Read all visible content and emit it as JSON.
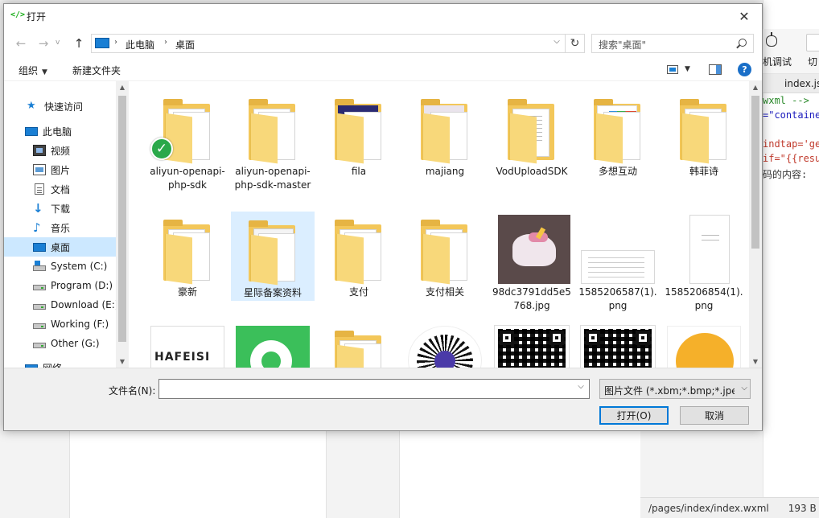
{
  "background": {
    "toolbar_labels": [
      "机调试",
      "切"
    ],
    "tab_label": "index.js",
    "code_lines": [
      {
        "text": "wxml -->",
        "color": "#2a8a2a"
      },
      {
        "text": "=\"containe",
        "color": "#1b1bbd"
      },
      {
        "text": "",
        "color": "#333333"
      },
      {
        "text": "indtap='ge",
        "color": "#c0392b"
      },
      {
        "text": "if=\"{{resu",
        "color": "#c0392b"
      },
      {
        "text": "码的内容:",
        "color": "#333333"
      }
    ],
    "status_path": "/pages/index/index.wxml",
    "status_size": "193 B"
  },
  "dialog": {
    "title": "打开",
    "title_icon": "</>",
    "close_glyph": "✕",
    "nav": {
      "back": "←",
      "forward": "→",
      "recent": "v",
      "up": "↑"
    },
    "address": {
      "segments": [
        "此电脑",
        "桌面"
      ],
      "separator": "›",
      "dropdown": "⌵"
    },
    "refresh_glyph": "↻",
    "search_placeholder": "搜索\"桌面\"",
    "toolbar": {
      "organize": "组织",
      "new_folder": "新建文件夹",
      "caret": "▼",
      "help": "?"
    },
    "sidebar": [
      {
        "label": "快速访问",
        "icon": "star-icon",
        "indent": 28,
        "glyph": "★"
      },
      {
        "label": "此电脑",
        "icon": "computer-icon",
        "indent": 26,
        "glyph": ""
      },
      {
        "label": "视频",
        "icon": "video-icon",
        "indent": 36,
        "glyph": ""
      },
      {
        "label": "图片",
        "icon": "image-icon",
        "indent": 36,
        "glyph": ""
      },
      {
        "label": "文档",
        "icon": "document-icon",
        "indent": 36,
        "glyph": ""
      },
      {
        "label": "下载",
        "icon": "download-icon",
        "indent": 36,
        "glyph": "↓"
      },
      {
        "label": "音乐",
        "icon": "music-icon",
        "indent": 36,
        "glyph": "♪"
      },
      {
        "label": "桌面",
        "icon": "desktop-icon",
        "indent": 36,
        "glyph": "",
        "selected": true
      },
      {
        "label": "System (C:)",
        "icon": "system-drive-icon",
        "indent": 36,
        "glyph": ""
      },
      {
        "label": "Program (D:)",
        "icon": "drive-icon",
        "indent": 36,
        "glyph": ""
      },
      {
        "label": "Download (E:)",
        "icon": "drive-icon",
        "indent": 36,
        "glyph": ""
      },
      {
        "label": "Working (F:)",
        "icon": "drive-icon",
        "indent": 36,
        "glyph": ""
      },
      {
        "label": "Other (G:)",
        "icon": "drive-icon",
        "indent": 36,
        "glyph": ""
      },
      {
        "label": "网络",
        "icon": "network-icon",
        "indent": 26,
        "glyph": ""
      }
    ],
    "files": [
      {
        "name": "aliyun-openapi-php-sdk",
        "kind": "folder-synced"
      },
      {
        "name": "aliyun-openapi-php-sdk-master",
        "kind": "folder"
      },
      {
        "name": "fila",
        "kind": "folder-fila",
        "cover_text": "EF DAY"
      },
      {
        "name": "majiang",
        "kind": "folder-majiang"
      },
      {
        "name": "VodUploadSDK",
        "kind": "folder-empty"
      },
      {
        "name": "多想互动",
        "kind": "folder-dd"
      },
      {
        "name": "韩菲诗",
        "kind": "folder"
      },
      {
        "name": "豪新",
        "kind": "folder-chart"
      },
      {
        "name": "星际备案资料",
        "kind": "folder-edge",
        "selected": true,
        "cover_letter": "e",
        "cover_sub": "pdf"
      },
      {
        "name": "支付",
        "kind": "folder"
      },
      {
        "name": "支付相关",
        "kind": "folder"
      },
      {
        "name": "98dc3791dd5e5768.jpg",
        "kind": "photo"
      },
      {
        "name": "1585206587(1).png",
        "kind": "screenshot"
      },
      {
        "name": "1585206854(1).png",
        "kind": "screenshot-tall"
      },
      {
        "name": "",
        "kind": "hafeisi",
        "logo_text": "HAFEISI"
      },
      {
        "name": "",
        "kind": "green-app"
      },
      {
        "name": "",
        "kind": "folder"
      },
      {
        "name": "",
        "kind": "qr-round"
      },
      {
        "name": "",
        "kind": "qr"
      },
      {
        "name": "",
        "kind": "qr"
      },
      {
        "name": "",
        "kind": "cartoon"
      }
    ],
    "filename_label": "文件名(N):",
    "filename_value": "",
    "filetype": "图片文件 (*.xbm;*.bmp;*.jpeg",
    "open_button": "打开(O)",
    "cancel_button": "取消"
  }
}
